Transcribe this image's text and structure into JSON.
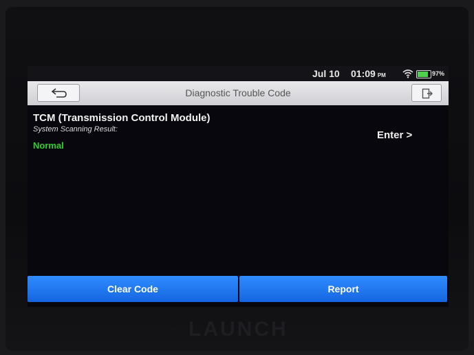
{
  "status_bar": {
    "date": "Jul 10",
    "time": "01:09",
    "ampm": "PM",
    "battery": "97%",
    "battery_level_percent": 97,
    "wifi_icon": "wifi-icon",
    "battery_icon": "battery-icon"
  },
  "title_bar": {
    "title": "Diagnostic Trouble Code",
    "back_icon": "back-arrow-icon",
    "exit_icon": "exit-icon"
  },
  "module": {
    "name": "TCM (Transmission Control Module)",
    "scan_label": "System Scanning Result:",
    "result": "Normal",
    "enter_label": "Enter >"
  },
  "buttons": {
    "clear_code": "Clear Code",
    "report": "Report"
  },
  "device": {
    "brand": "LAUNCH"
  },
  "colors": {
    "accent_blue": "#1e78f0",
    "status_ok": "#2fd12f",
    "screen_bg": "#07070d"
  }
}
